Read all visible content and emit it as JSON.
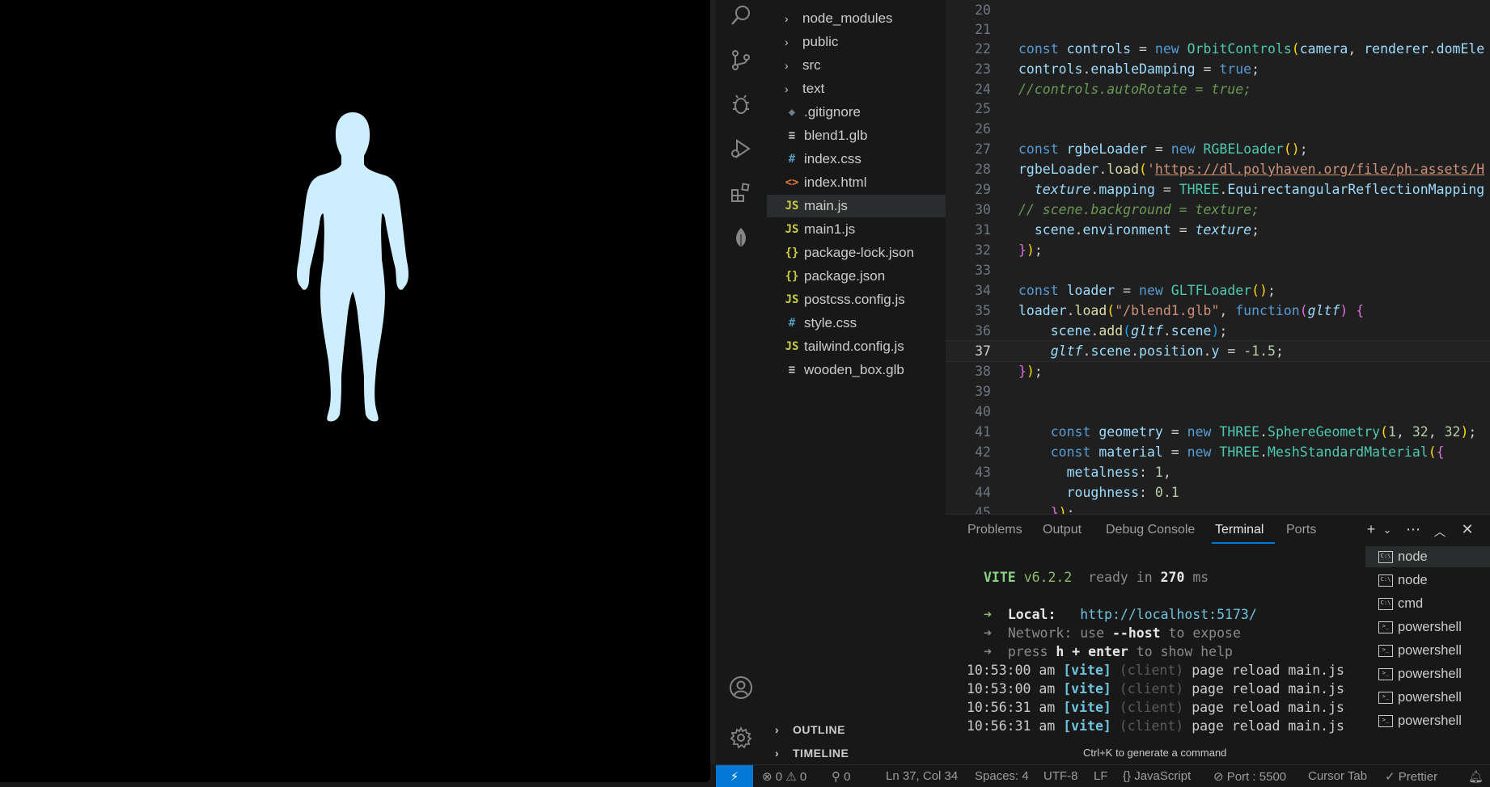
{
  "explorer": {
    "folders": [
      "node_modules",
      "public",
      "src",
      "text"
    ],
    "files": [
      {
        "name": ".gitignore",
        "icon": "git-icon",
        "glyph": "◆",
        "color": "#6b7d8f"
      },
      {
        "name": "blend1.glb",
        "icon": "file-lines-icon",
        "glyph": "≡",
        "color": "#cccccc"
      },
      {
        "name": "index.css",
        "icon": "css-hash-icon",
        "glyph": "#",
        "color": "#519aba"
      },
      {
        "name": "index.html",
        "icon": "html-brackets-icon",
        "glyph": "<>",
        "color": "#e37933"
      },
      {
        "name": "main.js",
        "icon": "js-icon",
        "glyph": "JS",
        "color": "#cbcb41",
        "selected": true
      },
      {
        "name": "main1.js",
        "icon": "js-icon",
        "glyph": "JS",
        "color": "#cbcb41"
      },
      {
        "name": "package-lock.json",
        "icon": "json-braces-icon",
        "glyph": "{}",
        "color": "#cbcb41"
      },
      {
        "name": "package.json",
        "icon": "json-braces-icon",
        "glyph": "{}",
        "color": "#cbcb41"
      },
      {
        "name": "postcss.config.js",
        "icon": "js-icon",
        "glyph": "JS",
        "color": "#cbcb41"
      },
      {
        "name": "style.css",
        "icon": "css-hash-icon",
        "glyph": "#",
        "color": "#519aba"
      },
      {
        "name": "tailwind.config.js",
        "icon": "js-icon",
        "glyph": "JS",
        "color": "#cbcb41"
      },
      {
        "name": "wooden_box.glb",
        "icon": "file-lines-icon",
        "glyph": "≡",
        "color": "#cccccc"
      }
    ],
    "outline": "OUTLINE",
    "timeline": "TIMELINE"
  },
  "editor": {
    "lines": [
      "20",
      "21",
      "22",
      "23",
      "24",
      "25",
      "26",
      "27",
      "28",
      "29",
      "30",
      "31",
      "32",
      "33",
      "34",
      "35",
      "36",
      "37",
      "38",
      "39",
      "40",
      "41",
      "42",
      "43",
      "44",
      "45"
    ],
    "current_line": "37"
  },
  "panel": {
    "tabs": [
      "Problems",
      "Output",
      "Debug Console",
      "Terminal",
      "Ports"
    ],
    "active_tab": "Terminal",
    "terminal": {
      "vite": "VITE",
      "version": "v6.2.2",
      "ready": "ready in",
      "ms": "270",
      "ms_unit": "ms",
      "arrow": "➜",
      "local_label": "Local:",
      "local_url": "http://localhost:5173/",
      "network_label": "Network:",
      "network_text": " use ",
      "network_flag": "--host",
      "network_tail": " to expose",
      "press": "press ",
      "press_key": "h + enter",
      "press_tail": " to show help",
      "logs": [
        {
          "time": "10:53:00 am",
          "tag": "[vite]",
          "client": "(client)",
          "msg": "page reload main.js"
        },
        {
          "time": "10:53:00 am",
          "tag": "[vite]",
          "client": "(client)",
          "msg": "page reload main.js"
        },
        {
          "time": "10:56:31 am",
          "tag": "[vite]",
          "client": "(client)",
          "msg": "page reload main.js"
        },
        {
          "time": "10:56:31 am",
          "tag": "[vite]",
          "client": "(client)",
          "msg": "page reload main.js"
        }
      ]
    },
    "terminals": [
      {
        "name": "node",
        "icon": "cmd-icon",
        "glyph": "C:\\"
      },
      {
        "name": "node",
        "icon": "cmd-icon",
        "glyph": "C:\\"
      },
      {
        "name": "cmd",
        "icon": "cmd-icon",
        "glyph": "C:\\"
      },
      {
        "name": "powershell",
        "icon": "powershell-icon",
        "glyph": ">_"
      },
      {
        "name": "powershell",
        "icon": "powershell-icon",
        "glyph": ">_"
      },
      {
        "name": "powershell",
        "icon": "powershell-icon",
        "glyph": ">_"
      },
      {
        "name": "powershell",
        "icon": "powershell-icon",
        "glyph": ">_"
      },
      {
        "name": "powershell",
        "icon": "powershell-icon",
        "glyph": ">_"
      }
    ],
    "hint": "Ctrl+K to generate a command"
  },
  "statusbar": {
    "remote": "⚡",
    "errors": "0",
    "warnings": "0",
    "ports_count": "0",
    "position": "Ln 37, Col 34",
    "spaces": "Spaces: 4",
    "encoding": "UTF-8",
    "eol": "LF",
    "language": "JavaScript",
    "port": "Port : 5500",
    "cursor_tab": "Cursor Tab",
    "prettier": "Prettier"
  },
  "colors": {
    "accent": "#0078d4",
    "figure": "#cdeeff"
  }
}
